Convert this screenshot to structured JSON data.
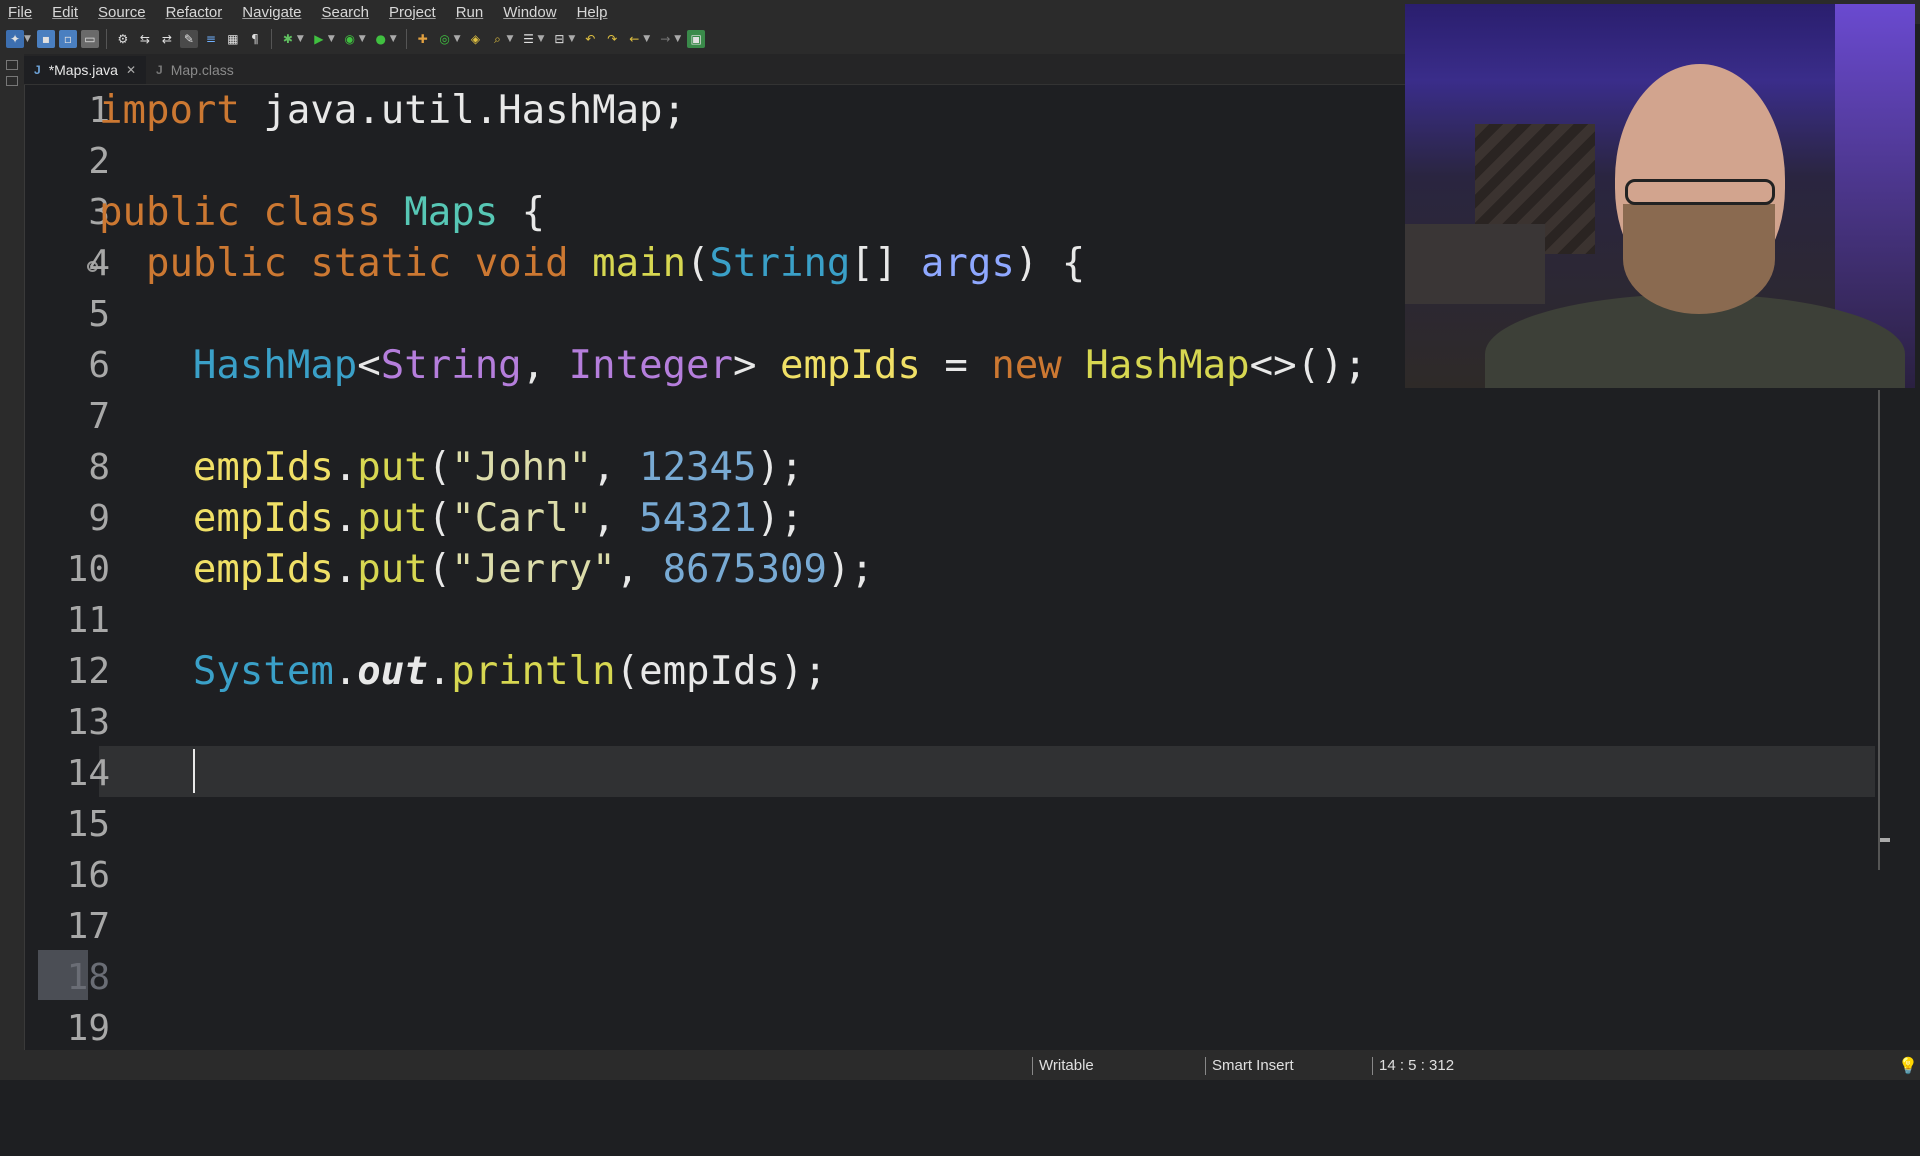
{
  "menu": [
    "File",
    "Edit",
    "Source",
    "Refactor",
    "Navigate",
    "Search",
    "Project",
    "Run",
    "Window",
    "Help"
  ],
  "tabs": [
    {
      "label": "*Maps.java",
      "active": true,
      "closable": true
    },
    {
      "label": "Map.class",
      "active": false,
      "closable": false
    }
  ],
  "editor": {
    "line_numbers": [
      "1",
      "2",
      "3",
      "4",
      "5",
      "6",
      "7",
      "8",
      "9",
      "10",
      "11",
      "12",
      "13",
      "14",
      "15",
      "16",
      "17",
      "18",
      "19"
    ],
    "lines": {
      "l1": [
        "import",
        " java.util.HashMap;"
      ],
      "l3": [
        "public",
        " ",
        "class",
        " ",
        "Maps",
        " {"
      ],
      "l4": [
        "public",
        " ",
        "static",
        " ",
        "void",
        " ",
        "main",
        "(",
        "String",
        "[] ",
        "args",
        ") {"
      ],
      "l6": [
        "HashMap",
        "<",
        "String",
        ", ",
        "Integer",
        "> ",
        "empIds",
        " = ",
        "new",
        " ",
        "HashMap",
        "<>();"
      ],
      "l8": [
        "empIds",
        ".",
        "put",
        "(",
        "\"John\"",
        ", ",
        "12345",
        ");"
      ],
      "l9": [
        "empIds",
        ".",
        "put",
        "(",
        "\"Carl\"",
        ", ",
        "54321",
        ");"
      ],
      "l10": [
        "empIds",
        ".",
        "put",
        "(",
        "\"Jerry\"",
        ", ",
        "8675309",
        ");"
      ],
      "l12": [
        "System",
        ".",
        "out",
        ".",
        "println",
        "(empIds);"
      ]
    },
    "current_line": "14",
    "highlighted_line_number": "18"
  },
  "status": {
    "writable": "Writable",
    "insert_mode": "Smart Insert",
    "position": "14 : 5 : 312"
  },
  "colors": {
    "keyword": "#cc7832",
    "type": "#3aa0c8",
    "generic": "#b57edc",
    "method": "#d7d751",
    "number": "#78aad4",
    "background": "#1e1f22"
  }
}
